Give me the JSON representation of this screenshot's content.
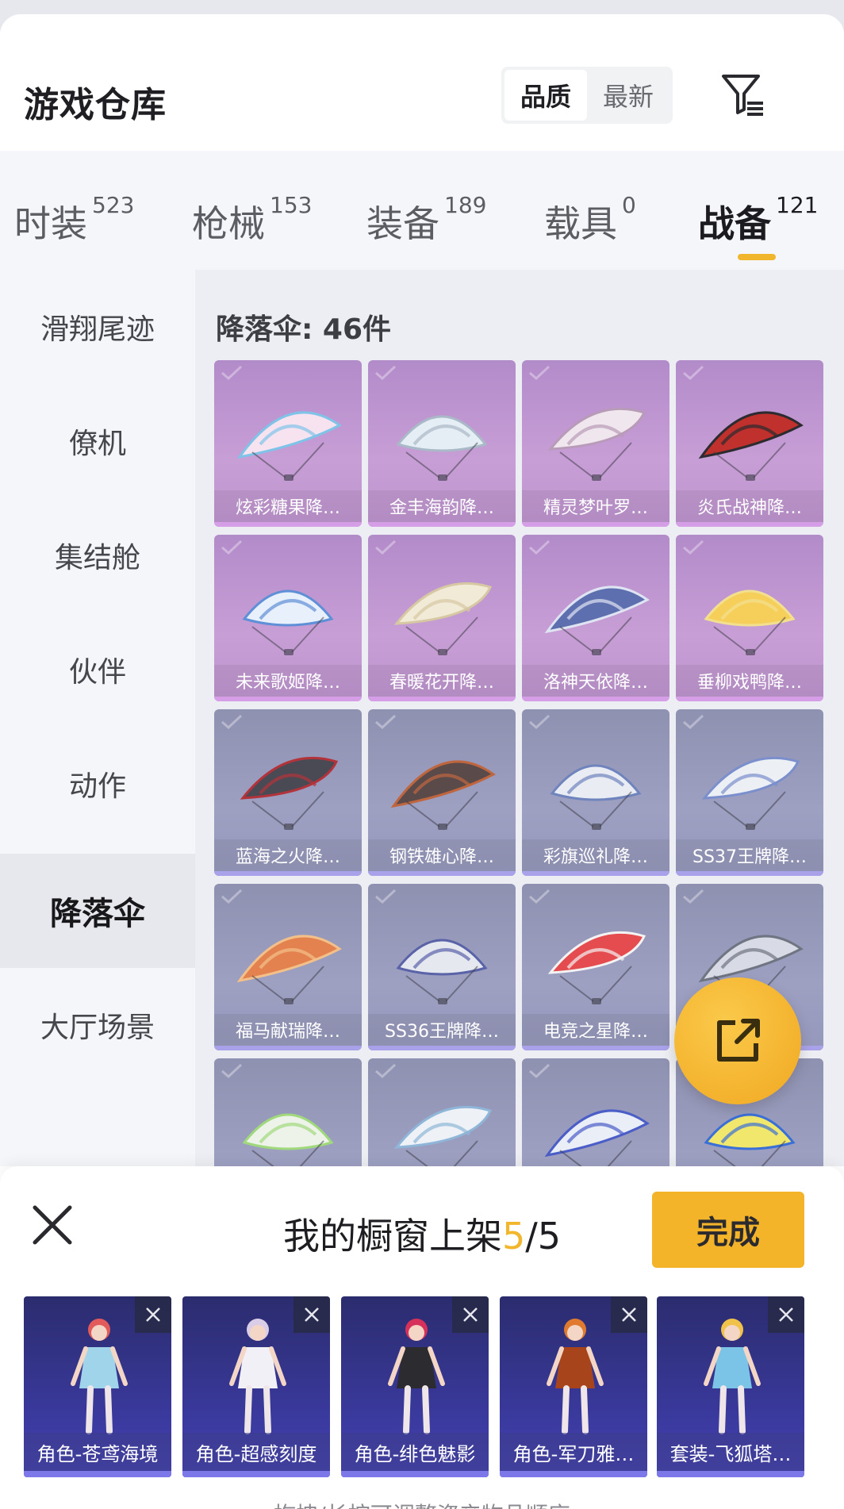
{
  "header": {
    "title": "游戏仓库",
    "sort_options": [
      "品质",
      "最新"
    ],
    "active_sort": "品质",
    "filter_icon": "filter-icon"
  },
  "tabs": [
    {
      "label": "时装",
      "count": "523"
    },
    {
      "label": "枪械",
      "count": "153"
    },
    {
      "label": "装备",
      "count": "189"
    },
    {
      "label": "载具",
      "count": "0"
    },
    {
      "label": "战备",
      "count": "121",
      "active": true
    }
  ],
  "sidebar": {
    "items": [
      "滑翔尾迹",
      "僚机",
      "集结舱",
      "伙伴",
      "动作",
      "降落伞",
      "大厅场景"
    ],
    "active": "降落伞"
  },
  "content": {
    "count_label": "降落伞: 46件",
    "items": [
      {
        "name": "炫彩糖果降…",
        "tier": "purple"
      },
      {
        "name": "金丰海韵降…",
        "tier": "purple"
      },
      {
        "name": "精灵梦叶罗…",
        "tier": "purple"
      },
      {
        "name": "炎氏战神降…",
        "tier": "purple"
      },
      {
        "name": "未来歌姬降…",
        "tier": "purple"
      },
      {
        "name": "春暖花开降…",
        "tier": "purple"
      },
      {
        "name": "洛神天依降…",
        "tier": "purple"
      },
      {
        "name": "垂柳戏鸭降…",
        "tier": "purple"
      },
      {
        "name": "蓝海之火降…",
        "tier": "blue"
      },
      {
        "name": "钢铁雄心降…",
        "tier": "blue"
      },
      {
        "name": "彩旗巡礼降…",
        "tier": "blue"
      },
      {
        "name": "SS37王牌降…",
        "tier": "blue"
      },
      {
        "name": "福马献瑞降…",
        "tier": "blue"
      },
      {
        "name": "SS36王牌降…",
        "tier": "blue"
      },
      {
        "name": "电竞之星降…",
        "tier": "blue"
      },
      {
        "name": "",
        "tier": "blue"
      },
      {
        "name": "",
        "tier": "blue"
      },
      {
        "name": "",
        "tier": "blue"
      },
      {
        "name": "",
        "tier": "blue"
      },
      {
        "name": "",
        "tier": "blue"
      }
    ],
    "colors": {
      "purple": "#c89ed6",
      "blue": "#9ea0c2",
      "accent": "#f2b62c"
    }
  },
  "share_fab": {
    "icon": "share-icon"
  },
  "panel": {
    "title_prefix": "我的橱窗上架",
    "count_current": "5",
    "count_sep": "/",
    "count_total": "5",
    "done_label": "完成",
    "showcase": [
      "角色-苍鸢海境",
      "角色-超感刻度",
      "角色-绯色魅影",
      "角色-军刀雅…",
      "套装-飞狐塔…"
    ],
    "hint": "拖拽/长按可调整资产物品顺序"
  }
}
